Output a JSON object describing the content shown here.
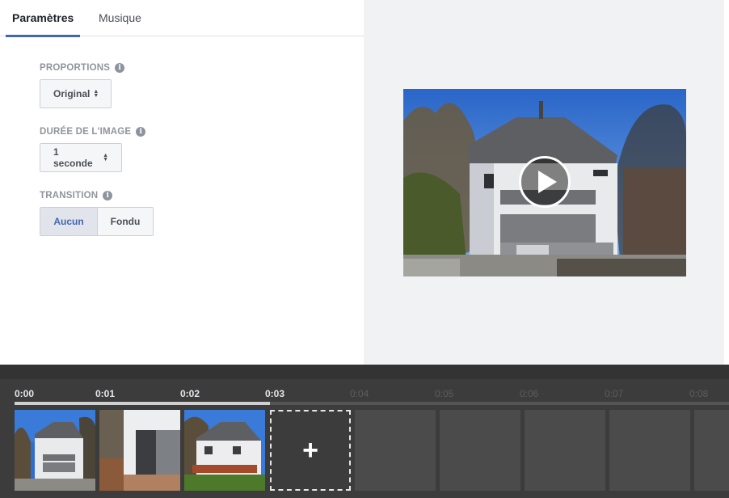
{
  "tabs": [
    {
      "label": "Paramètres",
      "active": true
    },
    {
      "label": "Musique",
      "active": false
    }
  ],
  "settings": {
    "proportions": {
      "label": "PROPORTIONS",
      "value": "Original"
    },
    "duration": {
      "label": "DURÉE DE L'IMAGE",
      "value": "1 seconde"
    },
    "transition": {
      "label": "TRANSITION",
      "options": [
        {
          "label": "Aucun",
          "selected": true
        },
        {
          "label": "Fondu",
          "selected": false
        }
      ]
    }
  },
  "preview": {
    "icon": "play-icon"
  },
  "timeline": {
    "ticks": [
      "0:00",
      "0:01",
      "0:02",
      "0:03",
      "0:04",
      "0:05",
      "0:06",
      "0:07",
      "0:08"
    ],
    "progress_seconds": 3,
    "add_icon": "plus-icon",
    "add_label": "+"
  },
  "colors": {
    "accent": "#4267b2",
    "timeline_bg": "#3c3c3c",
    "sky": "#2f6ed0"
  }
}
